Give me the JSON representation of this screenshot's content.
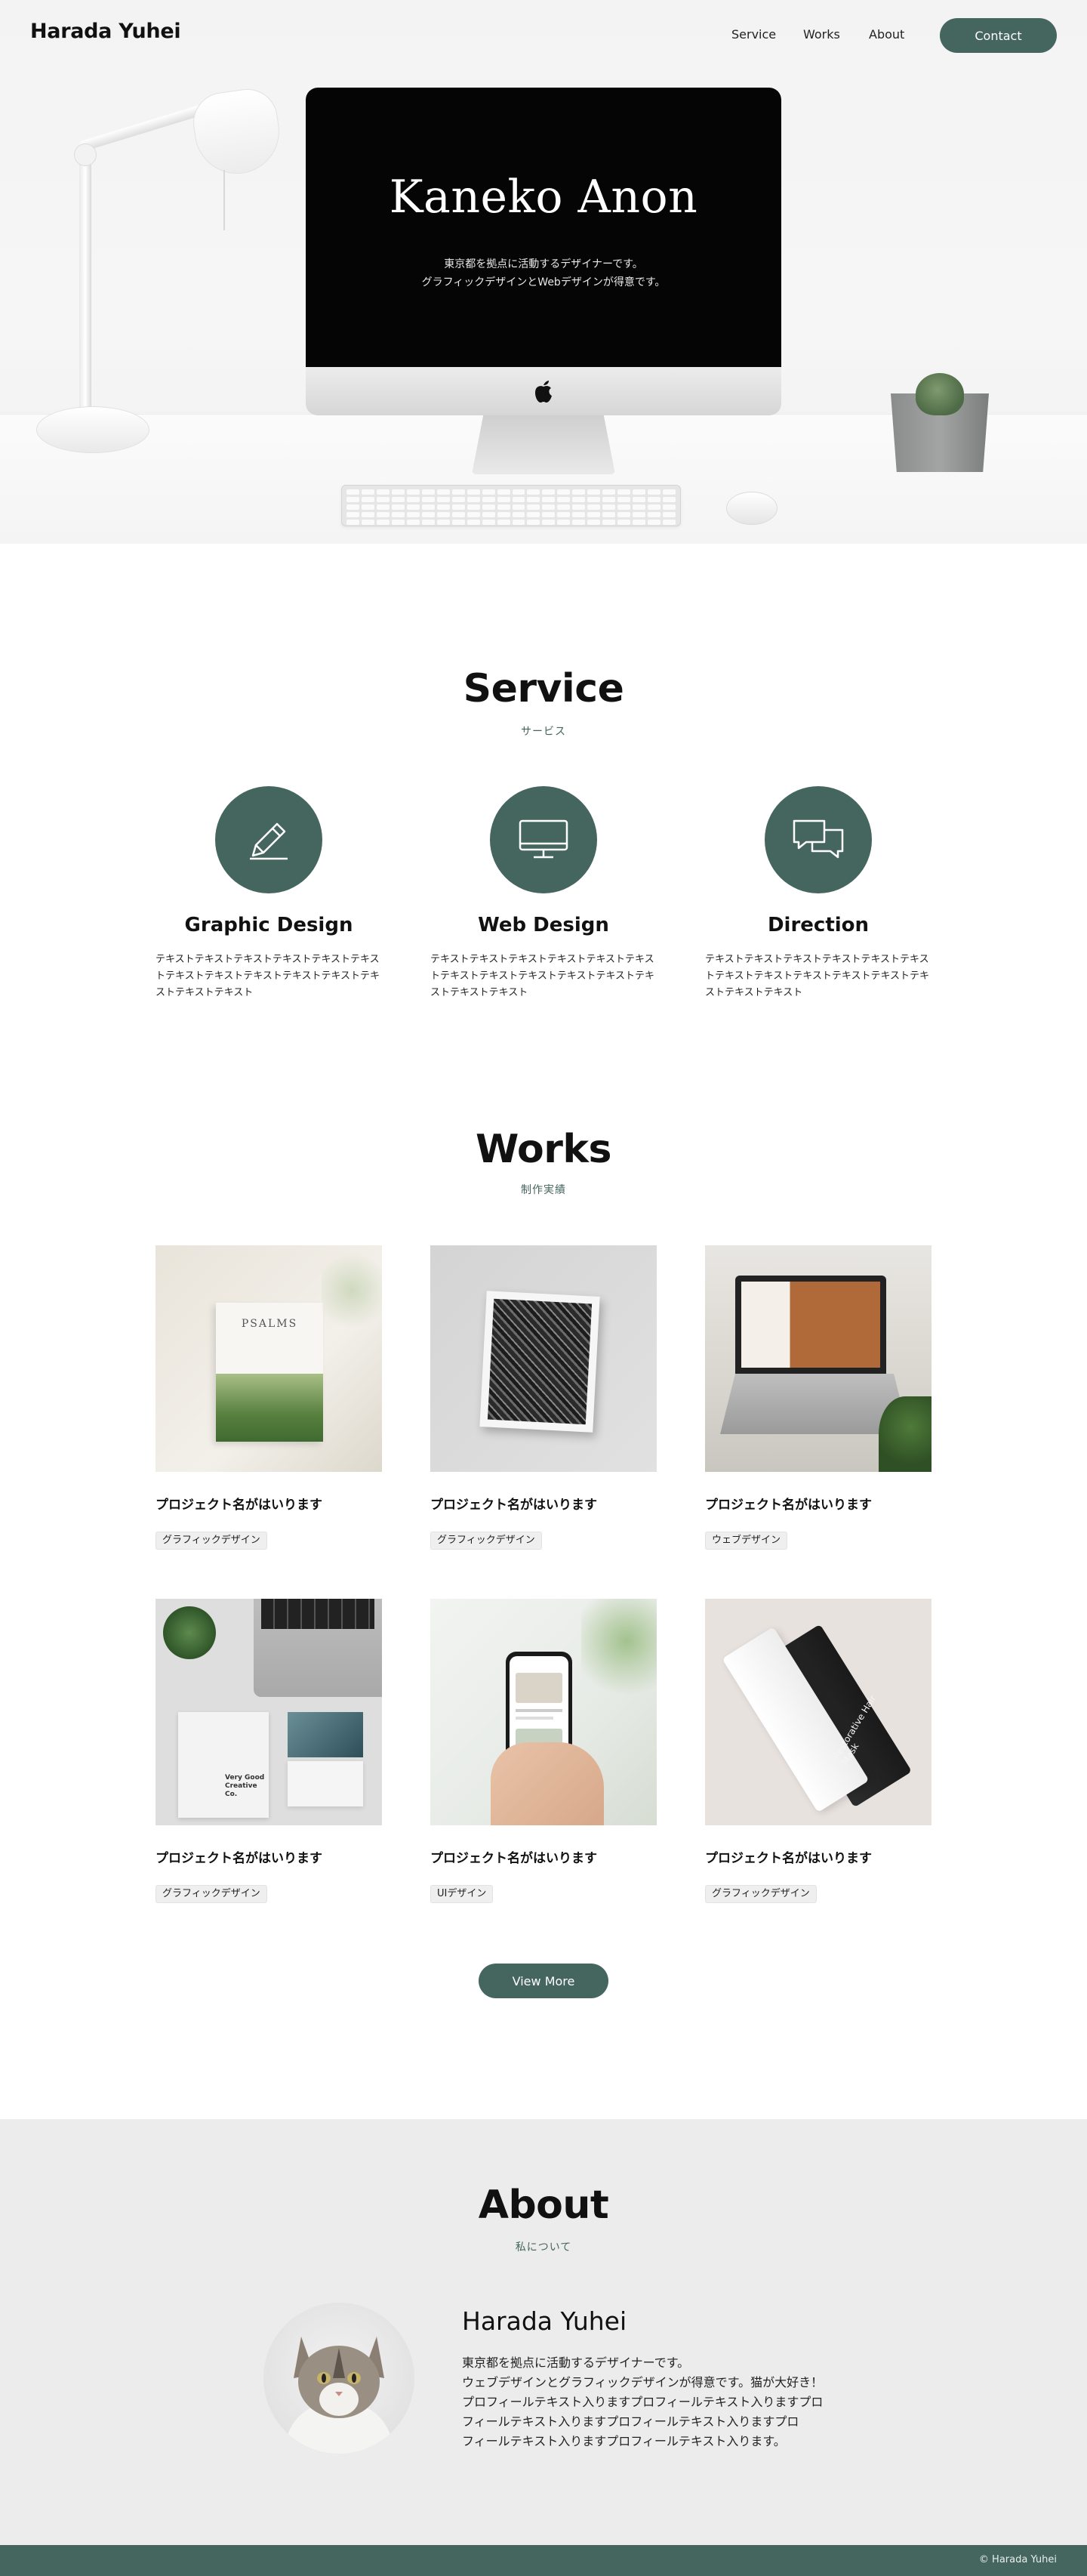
{
  "header": {
    "logo": "Harada Yuhei",
    "nav": [
      "Service",
      "Works",
      "About"
    ],
    "contact_label": "Contact"
  },
  "hero": {
    "name": "Kaneko Anon",
    "desc_line1": "東京都を拠点に活動するデザイナーです。",
    "desc_line2": "グラフィックデザインとWebデザインが得意です。"
  },
  "service": {
    "title": "Service",
    "subtitle": "サービス",
    "items": [
      {
        "name": "Graphic Design",
        "icon": "pencil-icon",
        "text": "テキストテキストテキストテキストテキストテキストテキストテキストテキストテキストテキストテキストテキストテキスト"
      },
      {
        "name": "Web Design",
        "icon": "monitor-icon",
        "text": "テキストテキストテキストテキストテキストテキストテキストテキストテキストテキストテキストテキストテキストテキスト"
      },
      {
        "name": "Direction",
        "icon": "chat-icon",
        "text": "テキストテキストテキストテキストテキストテキストテキストテキストテキストテキストテキストテキストテキストテキスト"
      }
    ]
  },
  "works": {
    "title": "Works",
    "subtitle": "制作実績",
    "items": [
      {
        "title": "プロジェクト名がはいります",
        "tag": "グラフィックデザイン",
        "image": "psalms-book-photo",
        "image_text": "PSALMS"
      },
      {
        "title": "プロジェクト名がはいります",
        "tag": "グラフィックデザイン",
        "image": "framed-aerial-photo"
      },
      {
        "title": "プロジェクト名がはいります",
        "tag": "ウェブデザイン",
        "image": "laptop-website-photo"
      },
      {
        "title": "プロジェクト名がはいります",
        "tag": "グラフィックデザイン",
        "image": "business-cards-photo",
        "image_text": "Very Good Creative Co."
      },
      {
        "title": "プロジェクト名がはいります",
        "tag": "UIデザイン",
        "image": "smartphone-app-photo"
      },
      {
        "title": "プロジェクト名がはいります",
        "tag": "グラフィックデザイン",
        "image": "cosmetic-tubes-photo",
        "image_text": "Restorative Hair Mask"
      }
    ],
    "view_more_label": "View More"
  },
  "about": {
    "title": "About",
    "subtitle": "私について",
    "name": "Harada Yuhei",
    "lines": [
      "東京都を拠点に活動するデザイナーです。",
      "ウェブデザインとグラフィックデザインが得意です。猫が大好き！",
      "プロフィールテキスト入りますプロフィールテキスト入りますプロ",
      "フィールテキスト入りますプロフィールテキスト入りますプロ",
      "フィールテキスト入りますプロフィールテキスト入ります。"
    ]
  },
  "footer": {
    "copyright": "© Harada Yuhei"
  },
  "colors": {
    "accent": "#45665e",
    "about_bg": "#ececec"
  }
}
